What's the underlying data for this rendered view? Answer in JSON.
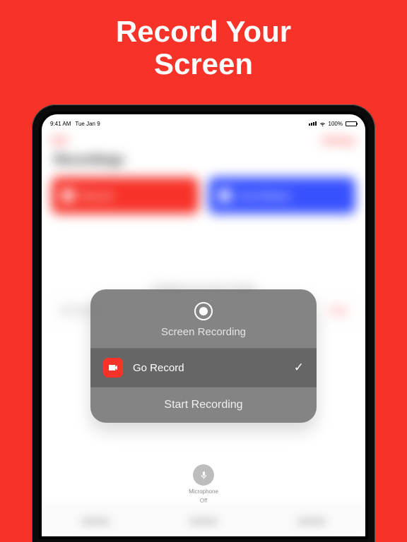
{
  "headline": {
    "line1": "Record Your",
    "line2": "Screen"
  },
  "status": {
    "time": "9:41 AM",
    "date": "Tue Jan 9",
    "battery_pct": "100%"
  },
  "background": {
    "left_action": "Edit",
    "right_action": "Settings",
    "title": "Recordings",
    "btn_record": "Record",
    "btn_stream": "Live Stream",
    "caption": "Everything on your screen, including",
    "row_action": "Share"
  },
  "panel": {
    "title": "Screen Recording",
    "app_name": "Go Record",
    "checkmark": "✓",
    "start_label": "Start Recording"
  },
  "mic": {
    "label_l1": "Microphone",
    "label_l2": "Off"
  }
}
